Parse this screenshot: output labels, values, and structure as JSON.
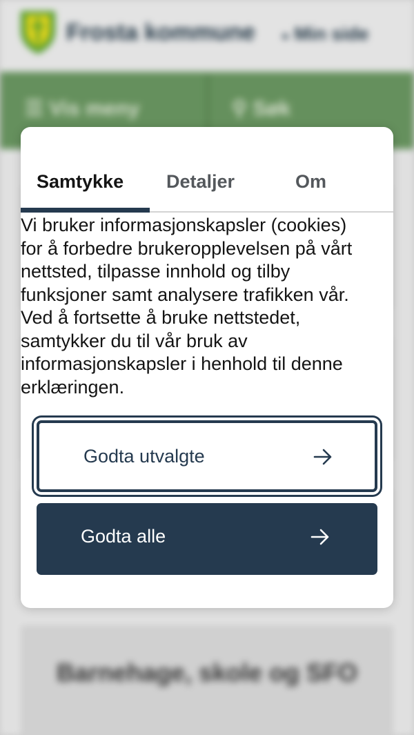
{
  "background": {
    "brand": "Frosta kommune",
    "my_page": "Min side",
    "menu": "Vis meny",
    "search": "Søk",
    "card_title": "Barnehage, skole og SFO"
  },
  "consent": {
    "tabs": [
      "Samtykke",
      "Detaljer",
      "Om"
    ],
    "active_tab": "Samtykke",
    "text_lines": [
      "Vi bruker informasjonskapsler (cookies)",
      "for å forbedre brukeropplevelsen på vårt",
      "nettsted, tilpasse innhold og tilby",
      "funksjoner samt analysere trafikken vår.",
      "Ved å fortsette å bruke nettstedet,",
      "samtykker du til vår bruk av",
      "informasjonskapsler i henhold til denne",
      "erklæringen."
    ],
    "accept_selected": "Godta utvalgte",
    "accept_all": "Godta alle"
  },
  "colors": {
    "primary": "#253a4f",
    "nav_green": "#6c9a63",
    "logo_yellow": "#f0e11e",
    "logo_green": "#5aa832"
  },
  "icons": {
    "arrow": "arrow-right-icon",
    "menu": "hamburger-icon",
    "search": "search-icon",
    "user": "user-icon"
  }
}
